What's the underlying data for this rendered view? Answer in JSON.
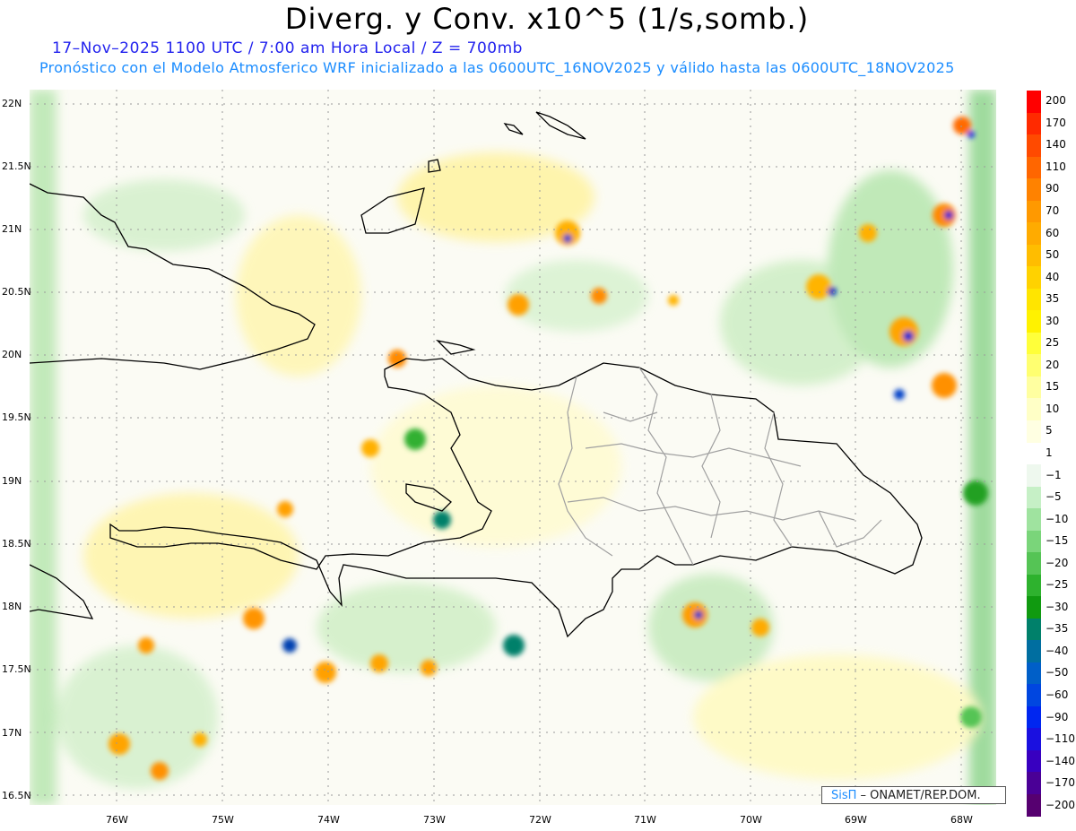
{
  "title": "Diverg. y Conv. x10^5 (1/s,somb.)",
  "subtitle_line1": "17–Nov–2025  1100 UTC / 7:00 am Hora Local / Z = 700mb",
  "subtitle_line2": "Pronóstico con el Modelo Atmosferico WRF inicializado a las 0600UTC_16NOV2025 y válido hasta las  0600UTC_18NOV2025",
  "map": {
    "lat_labels": [
      "22N",
      "21.5N",
      "21N",
      "20.5N",
      "20N",
      "19.5N",
      "19N",
      "18.5N",
      "18N",
      "17.5N",
      "17N",
      "16.5N"
    ],
    "lon_labels": [
      "76W",
      "75W",
      "74W",
      "73W",
      "72W",
      "71W",
      "70W",
      "69W",
      "68W"
    ]
  },
  "colorbar": {
    "labels": [
      "200",
      "170",
      "140",
      "110",
      "90",
      "70",
      "60",
      "50",
      "40",
      "35",
      "30",
      "25",
      "20",
      "15",
      "10",
      "5",
      "1",
      "−1",
      "−5",
      "−10",
      "−15",
      "−20",
      "−25",
      "−30",
      "−35",
      "−40",
      "−50",
      "−60",
      "−90",
      "−110",
      "−140",
      "−170",
      "−200"
    ],
    "colors": [
      "#ff0000",
      "#ff2a00",
      "#ff4a00",
      "#ff6600",
      "#ff8200",
      "#ff9900",
      "#ffab00",
      "#ffbd00",
      "#ffd200",
      "#ffe500",
      "#fff200",
      "#ffff3a",
      "#ffff70",
      "#ffffa0",
      "#ffffc6",
      "#ffffe2",
      "#ffffff",
      "#eef8ee",
      "#c6f0c6",
      "#9fe39f",
      "#7ad57a",
      "#55c455",
      "#2eb22e",
      "#109a10",
      "#00806a",
      "#006ea0",
      "#005fc8",
      "#0046e0",
      "#0026f0",
      "#1a10e0",
      "#3800c0",
      "#4a0096",
      "#560070"
    ]
  },
  "credit": {
    "brand": "SisΠ",
    "org": " – ONAMET/REP.DOM."
  }
}
